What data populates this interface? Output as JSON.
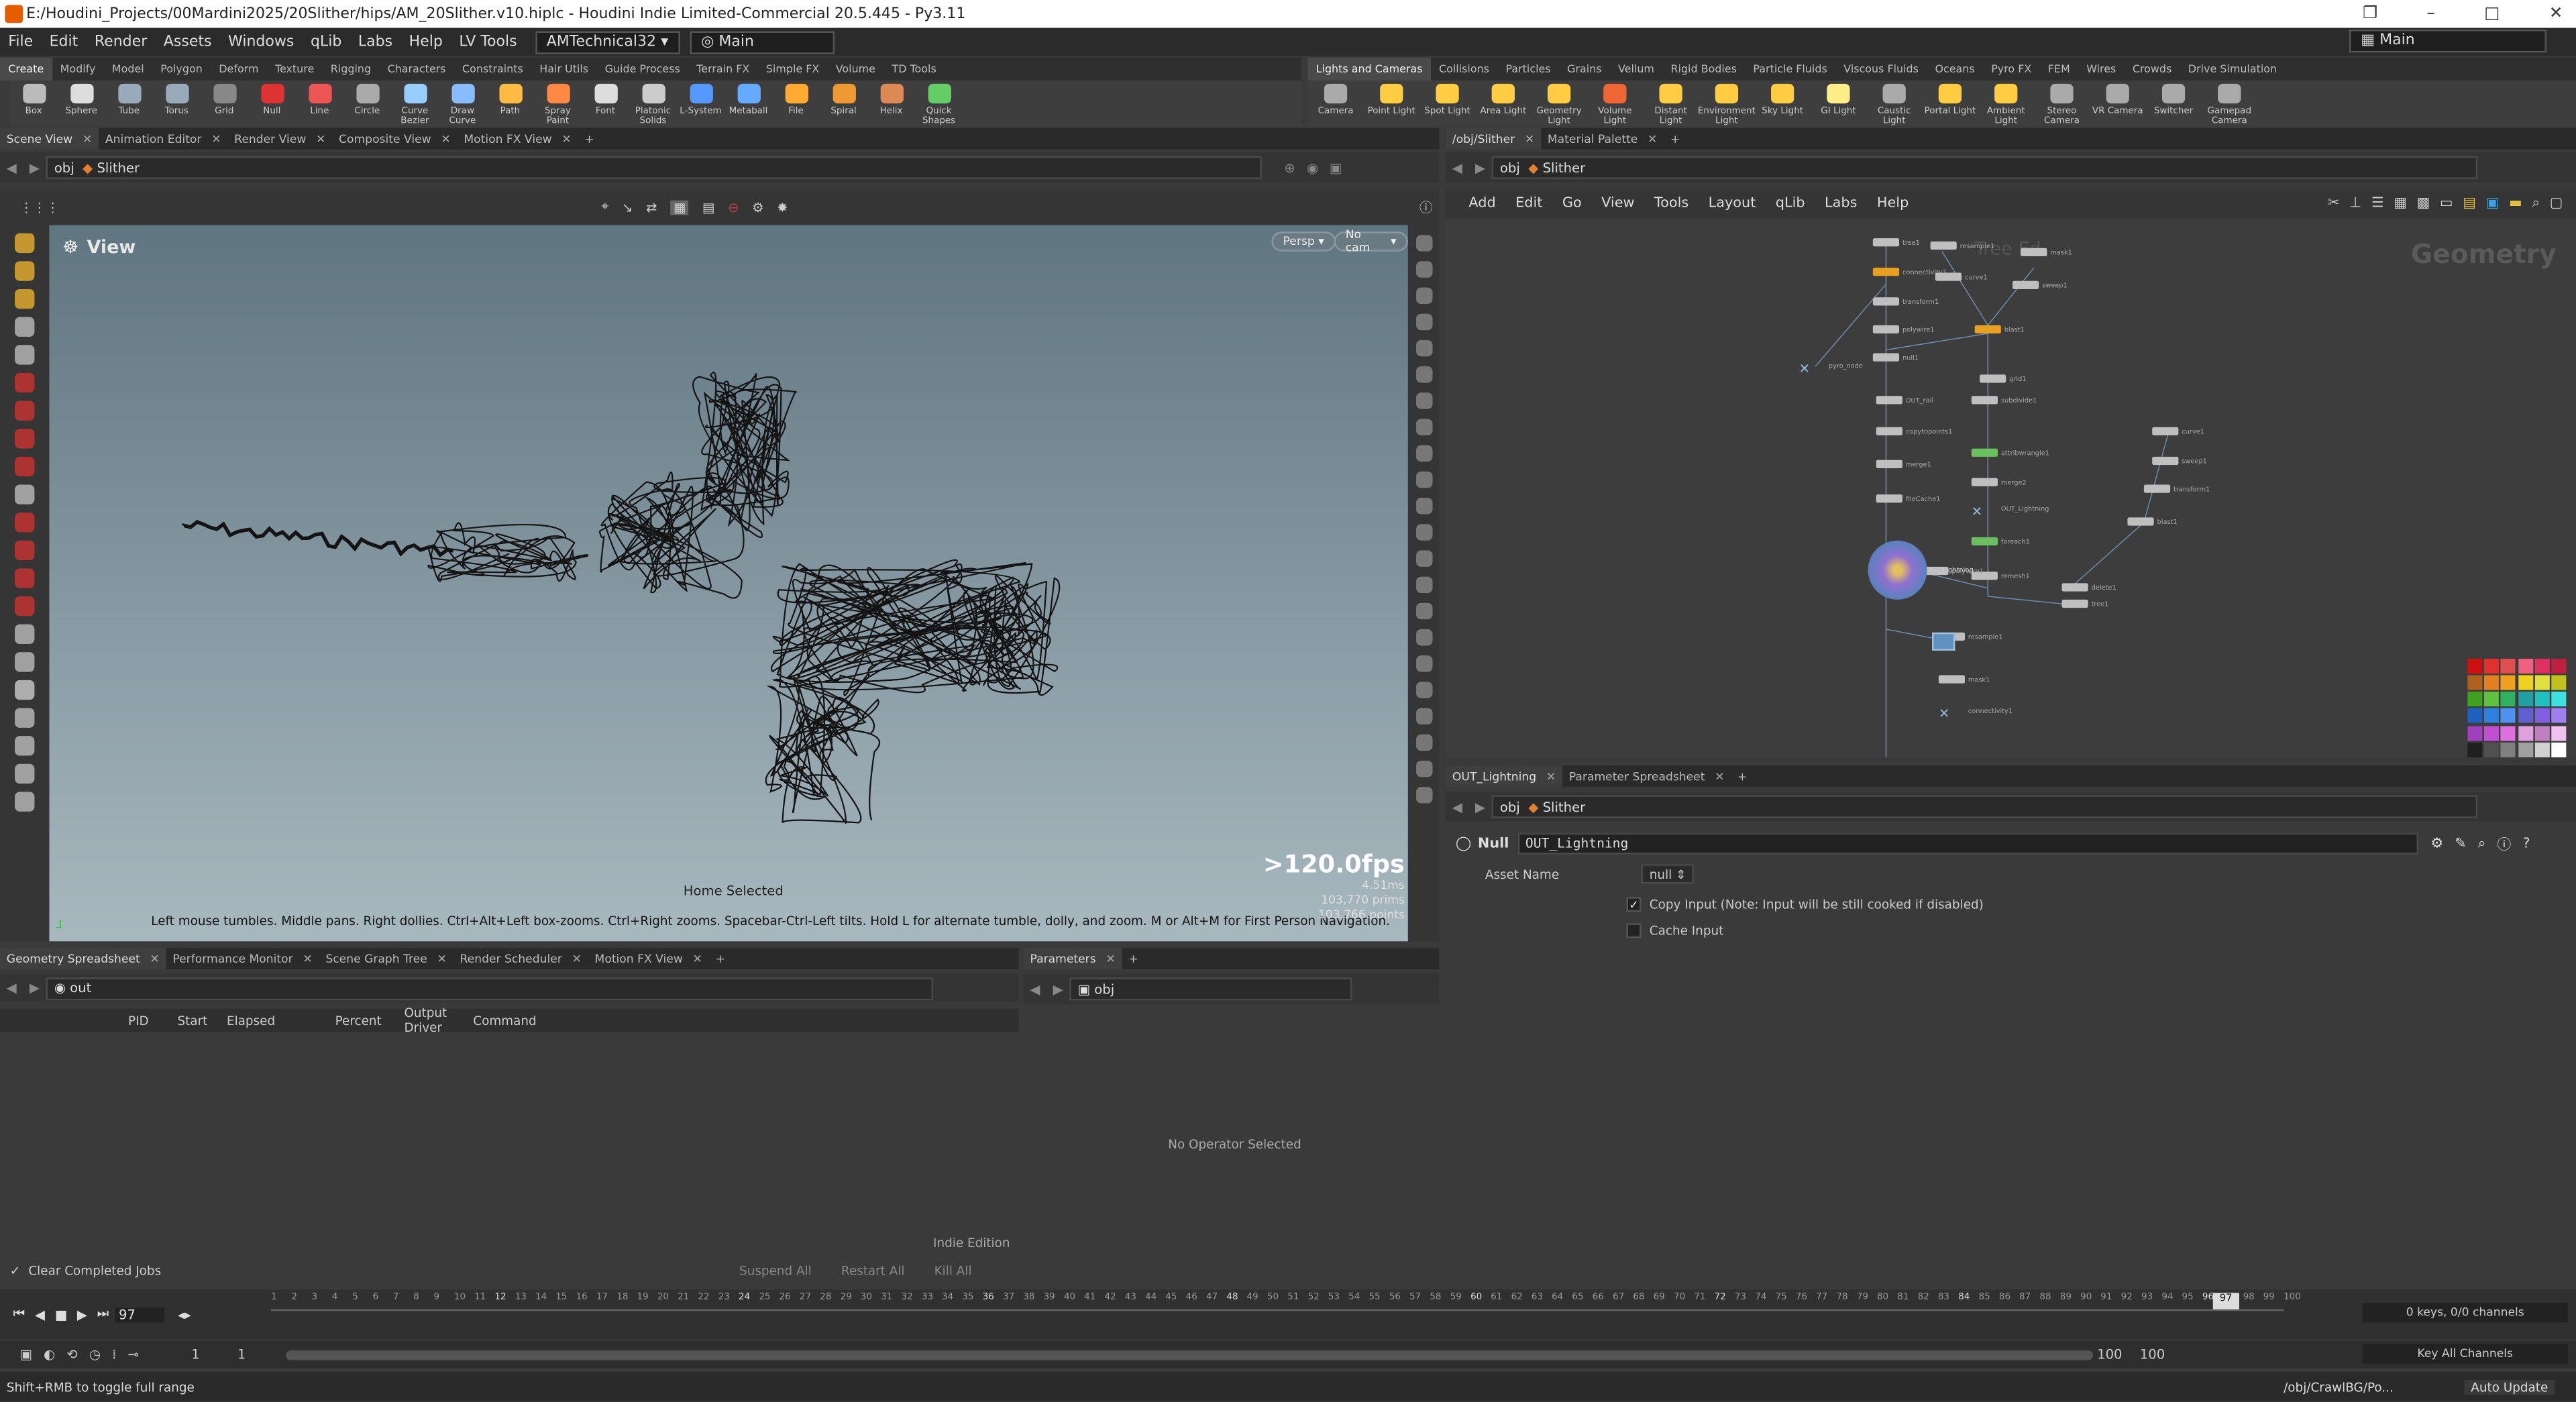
{
  "window": {
    "title": "E:/Houdini_Projects/00Mardini2025/20Slither/hips/AM_20Slither.v10.hiplc - Houdini Indie Limited-Commercial 20.5.445 - Py3.11",
    "main_desktop": "Main"
  },
  "menu": {
    "items": [
      "File",
      "Edit",
      "Render",
      "Assets",
      "Windows",
      "qLib",
      "Labs",
      "Help",
      "LV Tools"
    ],
    "desktop": "AMTechnical32",
    "layout": "Main"
  },
  "shelf_left": {
    "tabs": [
      "Create",
      "Modify",
      "Model",
      "Polygon",
      "Deform",
      "Texture",
      "Rigging",
      "Characters",
      "Constraints",
      "Hair Utils",
      "Guide Process",
      "Terrain FX",
      "Simple FX",
      "Volume",
      "TD Tools"
    ],
    "tools": [
      "Box",
      "Sphere",
      "Tube",
      "Torus",
      "Grid",
      "Null",
      "Line",
      "Circle",
      "Curve Bezier",
      "Draw Curve",
      "Path",
      "Spray Paint",
      "Font",
      "Platonic Solids",
      "L-System",
      "Metaball",
      "File",
      "Spiral",
      "Helix",
      "Quick Shapes"
    ]
  },
  "shelf_right": {
    "tabs": [
      "Lights and Cameras",
      "Collisions",
      "Particles",
      "Grains",
      "Vellum",
      "Rigid Bodies",
      "Particle Fluids",
      "Viscous Fluids",
      "Oceans",
      "Pyro FX",
      "FEM",
      "Wires",
      "Crowds",
      "Drive Simulation"
    ],
    "tools": [
      "Camera",
      "Point Light",
      "Spot Light",
      "Area Light",
      "Geometry Light",
      "Volume Light",
      "Distant Light",
      "Environment Light",
      "Sky Light",
      "GI Light",
      "Caustic Light",
      "Portal Light",
      "Ambient Light",
      "Stereo Camera",
      "VR Camera",
      "Switcher",
      "Gamepad Camera"
    ]
  },
  "left_pane": {
    "tabs": [
      "Scene View",
      "Animation Editor",
      "Render View",
      "Composite View",
      "Motion FX View"
    ],
    "path_context": "obj",
    "path_node": "Slither"
  },
  "viewport": {
    "label": "View",
    "persp": "Persp",
    "cam": "No cam",
    "fps": ">120.0fps",
    "stat_ms": "4.51ms",
    "stat_prims": "103,770  prims",
    "stat_points": "103,766  points",
    "home_selected": "Home Selected",
    "hint": "Left mouse tumbles. Middle pans. Right dollies. Ctrl+Alt+Left box-zooms. Ctrl+Right zooms. Spacebar-Ctrl-Left tilts. Hold L for alternate tumble, dolly, and zoom. M or Alt+M for First Person Navigation.",
    "curve_color": "#141414",
    "bg_top": "#5f7580",
    "bg_bottom": "#a8b8bf"
  },
  "right_pane": {
    "tabs": [
      "/obj/Slither",
      "Material Palette"
    ],
    "path_context": "obj",
    "path_node": "Slither",
    "menu": [
      "Add",
      "Edit",
      "Go",
      "View",
      "Tools",
      "Layout",
      "qLib",
      "Labs",
      "Help"
    ],
    "context_label": "Geometry",
    "watermark": "Tree Ed"
  },
  "nodes": {
    "active_name": "OUT_Lightning",
    "labels": [
      "tree1",
      "resample1",
      "mask1",
      "connectivity1",
      "curve1",
      "sweep1",
      "transform1",
      "blast1",
      "polywire1",
      "null1",
      "pyro_node",
      "grid1",
      "OUT_rail",
      "subdivide1",
      "copytopoints1",
      "attribwrangle1",
      "merge1",
      "merge2",
      "fileCache1",
      "OUT_Lightning",
      "foreach1",
      "remesh1",
      "delete1"
    ]
  },
  "params": {
    "tabs": [
      "OUT_Lightning",
      "Parameter Spreadsheet"
    ],
    "path_context": "obj",
    "path_node": "Slither",
    "node_type": "Null",
    "node_name": "OUT_Lightning",
    "asset_name_label": "Asset Name",
    "asset_name_value": "null",
    "copy_input_label": "Copy Input (Note: Input will be still cooked if disabled)",
    "cache_input_label": "Cache Input"
  },
  "bottom_left": {
    "tabs": [
      "Geometry Spreadsheet",
      "Performance Monitor",
      "Scene Graph Tree",
      "Render Scheduler",
      "Motion FX View"
    ],
    "path": "out",
    "columns": [
      "PID",
      "Start",
      "Elapsed",
      "Percent",
      "Output Driver",
      "Command"
    ],
    "edition": "Indie Edition",
    "clear_jobs": "Clear Completed Jobs",
    "suspend": "Suspend All",
    "restart": "Restart All",
    "kill": "Kill All"
  },
  "bottom_mid": {
    "tabs": [
      "Parameters"
    ],
    "path": "obj",
    "empty": "No Operator Selected"
  },
  "timeline": {
    "current_frame": "97",
    "start": "1",
    "end": "100",
    "range_start": "1",
    "range_end": "100",
    "range_end2": "100",
    "keys": "0 keys, 0/0 channels",
    "key_all": "Key All Channels",
    "ticks": [
      "1",
      "2",
      "3",
      "4",
      "5",
      "6",
      "7",
      "8",
      "9",
      "10",
      "11",
      "12",
      "13",
      "14",
      "15",
      "16",
      "17",
      "18",
      "19",
      "20",
      "21",
      "22",
      "23",
      "24",
      "25",
      "26",
      "27",
      "28",
      "29",
      "30",
      "31",
      "32",
      "33",
      "34",
      "35",
      "36",
      "37",
      "38",
      "39",
      "40",
      "41",
      "42",
      "43",
      "44",
      "45",
      "46",
      "47",
      "48",
      "49",
      "50",
      "51",
      "52",
      "53",
      "54",
      "55",
      "56",
      "57",
      "58",
      "59",
      "60",
      "61",
      "62",
      "63",
      "64",
      "65",
      "66",
      "67",
      "68",
      "69",
      "70",
      "71",
      "72",
      "73",
      "74",
      "75",
      "76",
      "77",
      "78",
      "79",
      "80",
      "81",
      "82",
      "83",
      "84",
      "85",
      "86",
      "87",
      "88",
      "89",
      "90",
      "91",
      "92",
      "93",
      "94",
      "95",
      "96",
      "97",
      "98",
      "99",
      "100"
    ]
  },
  "status": {
    "hint": "Shift+RMB to toggle full range",
    "path": "/obj/CrawlBG/Po...",
    "auto_update": "Auto Update"
  },
  "palette_colors": [
    "#d01010",
    "#e03030",
    "#e05050",
    "#f06080",
    "#e03060",
    "#c02040",
    "#b06020",
    "#e08020",
    "#f0a020",
    "#f0d020",
    "#e0e040",
    "#c0c020",
    "#40a020",
    "#60c040",
    "#30b060",
    "#20a0a0",
    "#20c0c0",
    "#40e0e0",
    "#2060c0",
    "#3080e0",
    "#5090f0",
    "#6060d0",
    "#8060e0",
    "#a080f0",
    "#a040c0",
    "#c050d0",
    "#e070e0",
    "#e0a0e0",
    "#c080c0",
    "#f0c0f0",
    "#202020",
    "#505050",
    "#808080",
    "#a0a0a0",
    "#d0d0d0",
    "#ffffff"
  ]
}
